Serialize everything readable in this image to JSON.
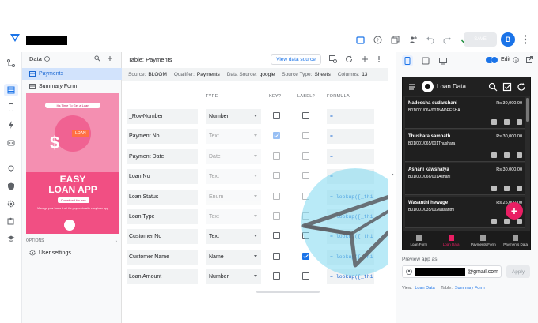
{
  "topbar": {
    "save_label": "SAVE",
    "avatar_letter": "B",
    "brand_color": "#1a73e8"
  },
  "data_panel": {
    "title": "Data",
    "items": [
      {
        "label": "Payments"
      },
      {
        "label": "Summary Form"
      }
    ],
    "promo": {
      "headline": "It's Time To Get a Loan",
      "badge": "LOAN",
      "line1": "EASY",
      "line2": "LOAN APP",
      "download": "Download for free",
      "small": "Manage your loans & all the payments with easy loan app"
    },
    "options_label": "OPTIONS",
    "user_settings": "User settings"
  },
  "table": {
    "title": "Table: Payments",
    "view_source": "View data source",
    "meta": {
      "source_label": "Source:",
      "source": "BLOOM",
      "qualifier_label": "Qualifier:",
      "qualifier": "Payments",
      "datasource_label": "Data Source:",
      "datasource": "google",
      "sourcetype_label": "Source Type:",
      "sourcetype": "Sheets",
      "columns_label": "Columns:",
      "columns": "13"
    },
    "headers": {
      "type": "TYPE",
      "key": "KEY?",
      "label": "LABEL?",
      "formula": "FORMULA"
    },
    "rows": [
      {
        "name": "_RowNumber",
        "type": "Number",
        "formula": "="
      },
      {
        "name": "Payment No",
        "type": "Text",
        "formula": "="
      },
      {
        "name": "Payment Date",
        "type": "Date",
        "formula": "="
      },
      {
        "name": "Loan No",
        "type": "Text",
        "formula": "="
      },
      {
        "name": "Loan Status",
        "type": "Enum",
        "formula": "= lookup([_thi"
      },
      {
        "name": "Loan Type",
        "type": "Text",
        "formula": "= lookup([_thi"
      },
      {
        "name": "Customer No",
        "type": "Text",
        "formula": "= lookup([_thi"
      },
      {
        "name": "Customer Name",
        "type": "Name",
        "formula": "= lookup([_thi"
      },
      {
        "name": "Loan Amount",
        "type": "Number",
        "formula": "= lookup([_thi"
      }
    ]
  },
  "preview": {
    "edit_label": "Edit",
    "app_title": "Loan Data",
    "cards": [
      {
        "name": "Nadeesha sudarshani",
        "amount": "Rs.30,000.00",
        "sub": "B01/001/064/001NADEESHA"
      },
      {
        "name": "Thushara sampath",
        "amount": "Rs.30,000.00",
        "sub": "B01/001/065/001Thushara"
      },
      {
        "name": "Ashani kawshalya",
        "amount": "Rs.30,000.00",
        "sub": "B01/001/066/001Ashani"
      },
      {
        "name": "Wasanthi hewage",
        "amount": "Rs.25,000.00",
        "sub": "B01/001/035/002wasanthi"
      }
    ],
    "nav": [
      {
        "label": "Loan Form"
      },
      {
        "label": "Loan Data"
      },
      {
        "label": "Payments Form"
      },
      {
        "label": "Payments Data"
      }
    ],
    "preview_as_label": "Preview app as",
    "email_suffix": "@gmail.com",
    "apply_label": "Apply",
    "view_label": "View:",
    "view_value": "Loan Data",
    "table_label": "Table:",
    "table_value": "Summary Form",
    "accent_color": "#e91e63"
  }
}
